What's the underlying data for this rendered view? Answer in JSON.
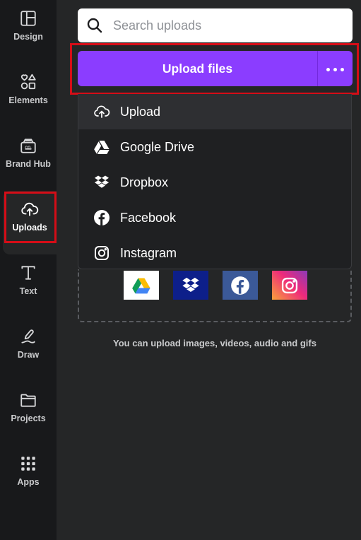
{
  "rail": {
    "items": [
      {
        "label": "Design",
        "icon": "design-icon"
      },
      {
        "label": "Elements",
        "icon": "elements-icon"
      },
      {
        "label": "Brand Hub",
        "icon": "brand-hub-icon"
      },
      {
        "label": "Uploads",
        "icon": "cloud-upload-icon",
        "active": true
      },
      {
        "label": "Text",
        "icon": "text-icon"
      },
      {
        "label": "Draw",
        "icon": "draw-icon"
      },
      {
        "label": "Projects",
        "icon": "folder-icon"
      },
      {
        "label": "Apps",
        "icon": "apps-grid-icon"
      }
    ]
  },
  "search": {
    "placeholder": "Search uploads"
  },
  "upload": {
    "label": "Upload files",
    "more_icon": "more-dots-icon",
    "accent": "#8b3dff"
  },
  "menu": {
    "items": [
      {
        "label": "Upload",
        "icon": "cloud-upload-icon"
      },
      {
        "label": "Google Drive",
        "icon": "google-drive-icon"
      },
      {
        "label": "Dropbox",
        "icon": "dropbox-icon"
      },
      {
        "label": "Facebook",
        "icon": "facebook-icon"
      },
      {
        "label": "Instagram",
        "icon": "instagram-icon"
      }
    ]
  },
  "sources": [
    "google-drive-icon",
    "dropbox-icon",
    "facebook-icon",
    "instagram-icon"
  ],
  "hint": "You can upload images, videos, audio and gifs",
  "colors": {
    "highlight": "#d50d17",
    "background": "#252627",
    "rail": "#18191b"
  }
}
